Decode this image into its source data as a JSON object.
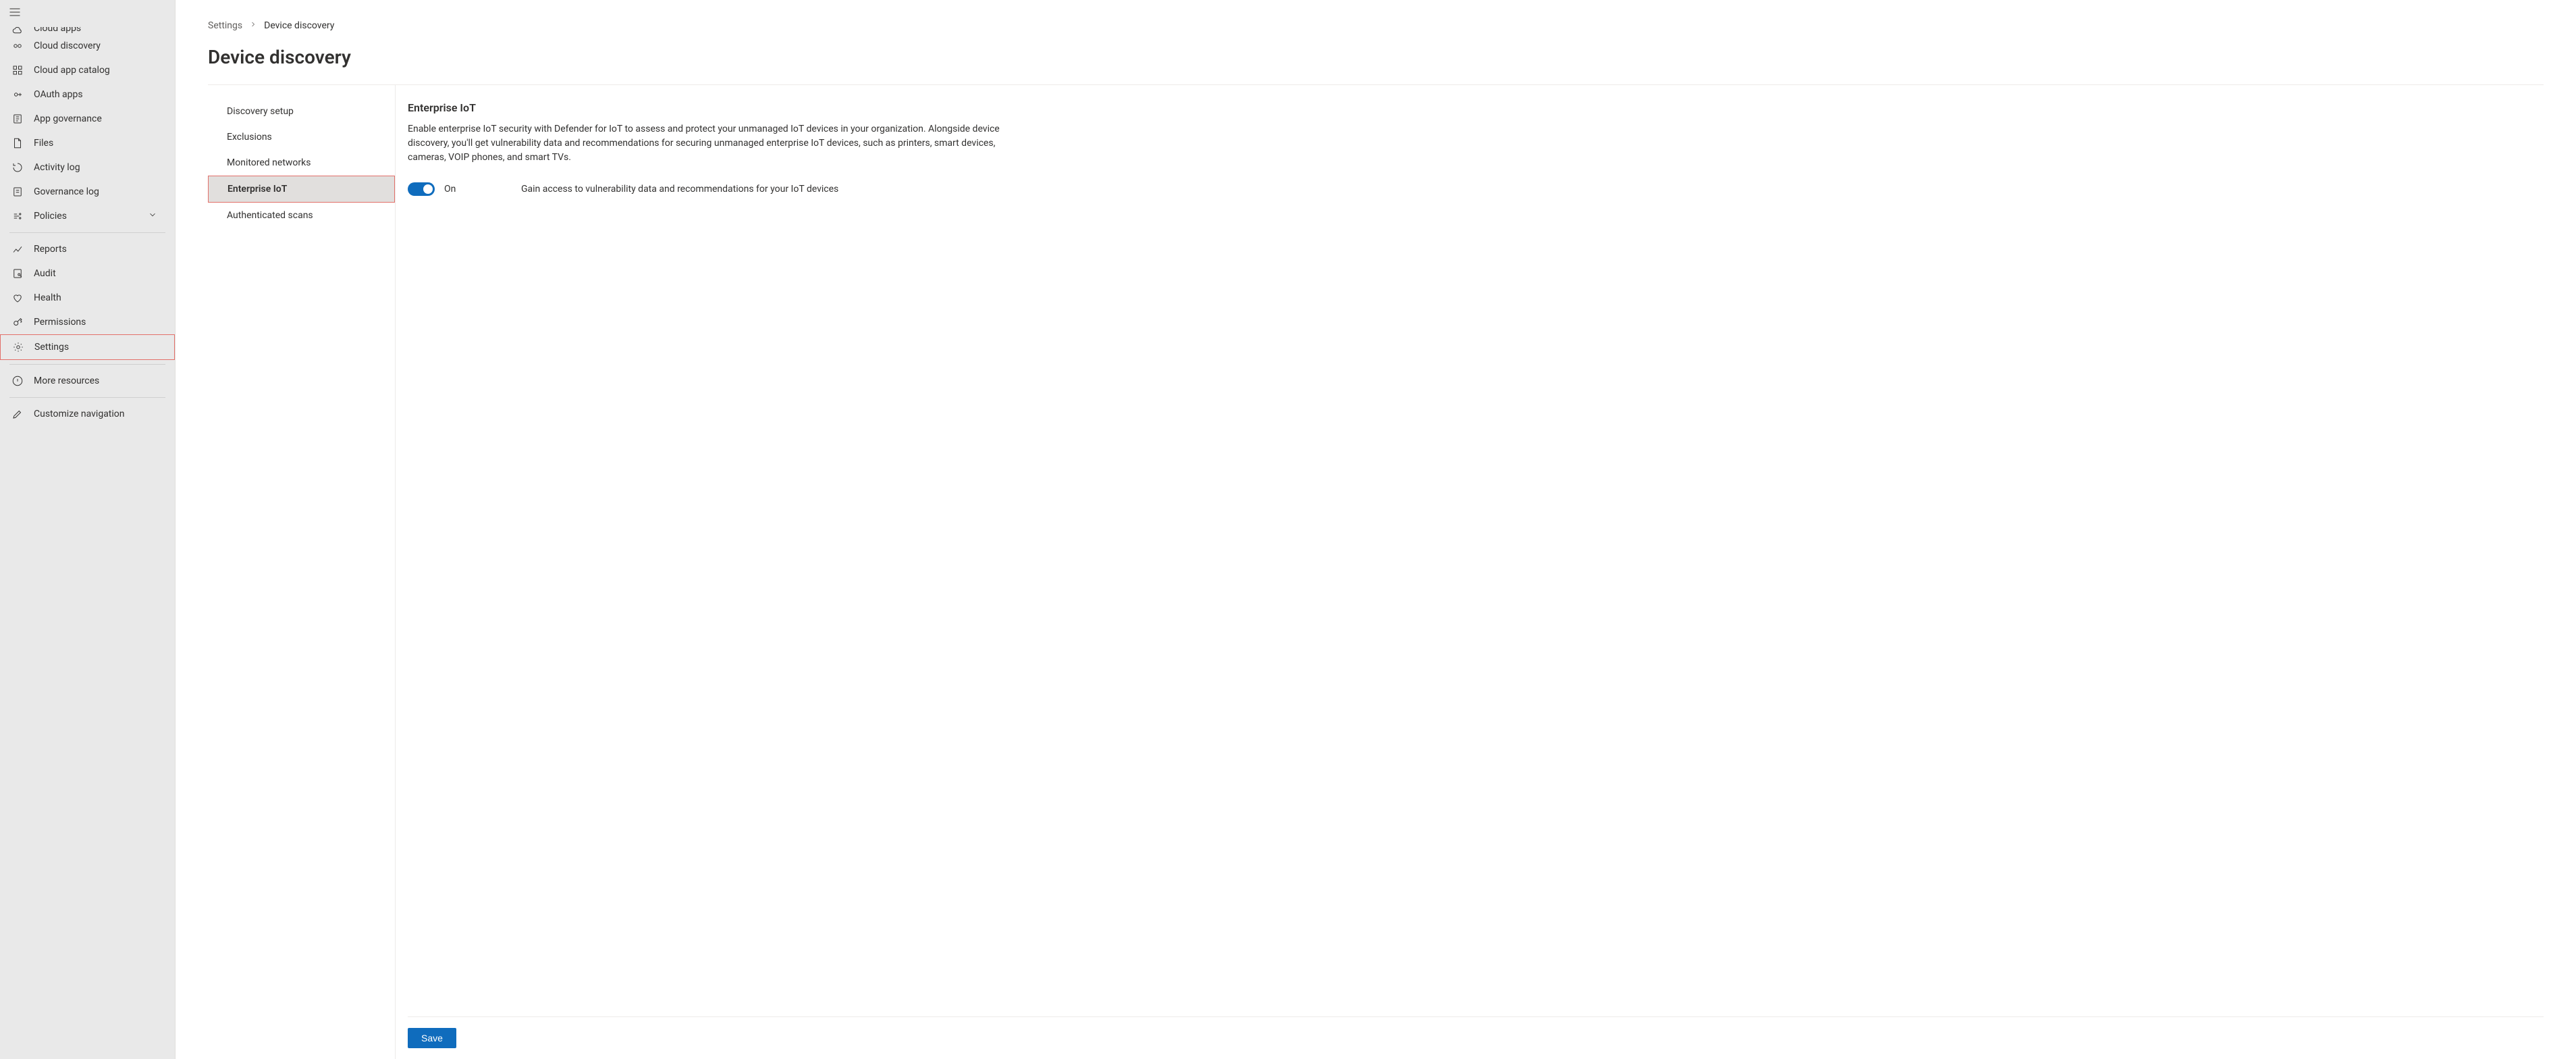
{
  "sidebar": {
    "items": [
      {
        "label": "Cloud apps",
        "cut": true
      },
      {
        "label": "Cloud discovery"
      },
      {
        "label": "Cloud app catalog"
      },
      {
        "label": "OAuth apps"
      },
      {
        "label": "App governance"
      },
      {
        "label": "Files"
      },
      {
        "label": "Activity log"
      },
      {
        "label": "Governance log"
      },
      {
        "label": "Policies",
        "chevron": true
      },
      {
        "divider": true
      },
      {
        "label": "Reports"
      },
      {
        "label": "Audit"
      },
      {
        "label": "Health"
      },
      {
        "label": "Permissions"
      },
      {
        "label": "Settings",
        "highlight": true
      },
      {
        "divider": true
      },
      {
        "label": "More resources"
      },
      {
        "divider": true
      },
      {
        "label": "Customize navigation"
      }
    ]
  },
  "breadcrumb": {
    "root": "Settings",
    "current": "Device discovery"
  },
  "page": {
    "title": "Device discovery"
  },
  "subnav": {
    "items": [
      {
        "label": "Discovery setup"
      },
      {
        "label": "Exclusions"
      },
      {
        "label": "Monitored networks"
      },
      {
        "label": "Enterprise IoT",
        "active": true,
        "highlight": true
      },
      {
        "label": "Authenticated scans"
      }
    ]
  },
  "pane": {
    "heading": "Enterprise IoT",
    "description": "Enable enterprise IoT security with Defender for IoT to assess and protect your unmanaged IoT devices in your organization. Alongside device discovery, you'll get vulnerability data and recommendations for securing unmanaged enterprise IoT devices, such as printers, smart devices, cameras, VOIP phones, and smart TVs.",
    "toggle": {
      "state_label": "On",
      "help": "Gain access to vulnerability data and recommendations for your IoT devices"
    },
    "save_label": "Save"
  }
}
